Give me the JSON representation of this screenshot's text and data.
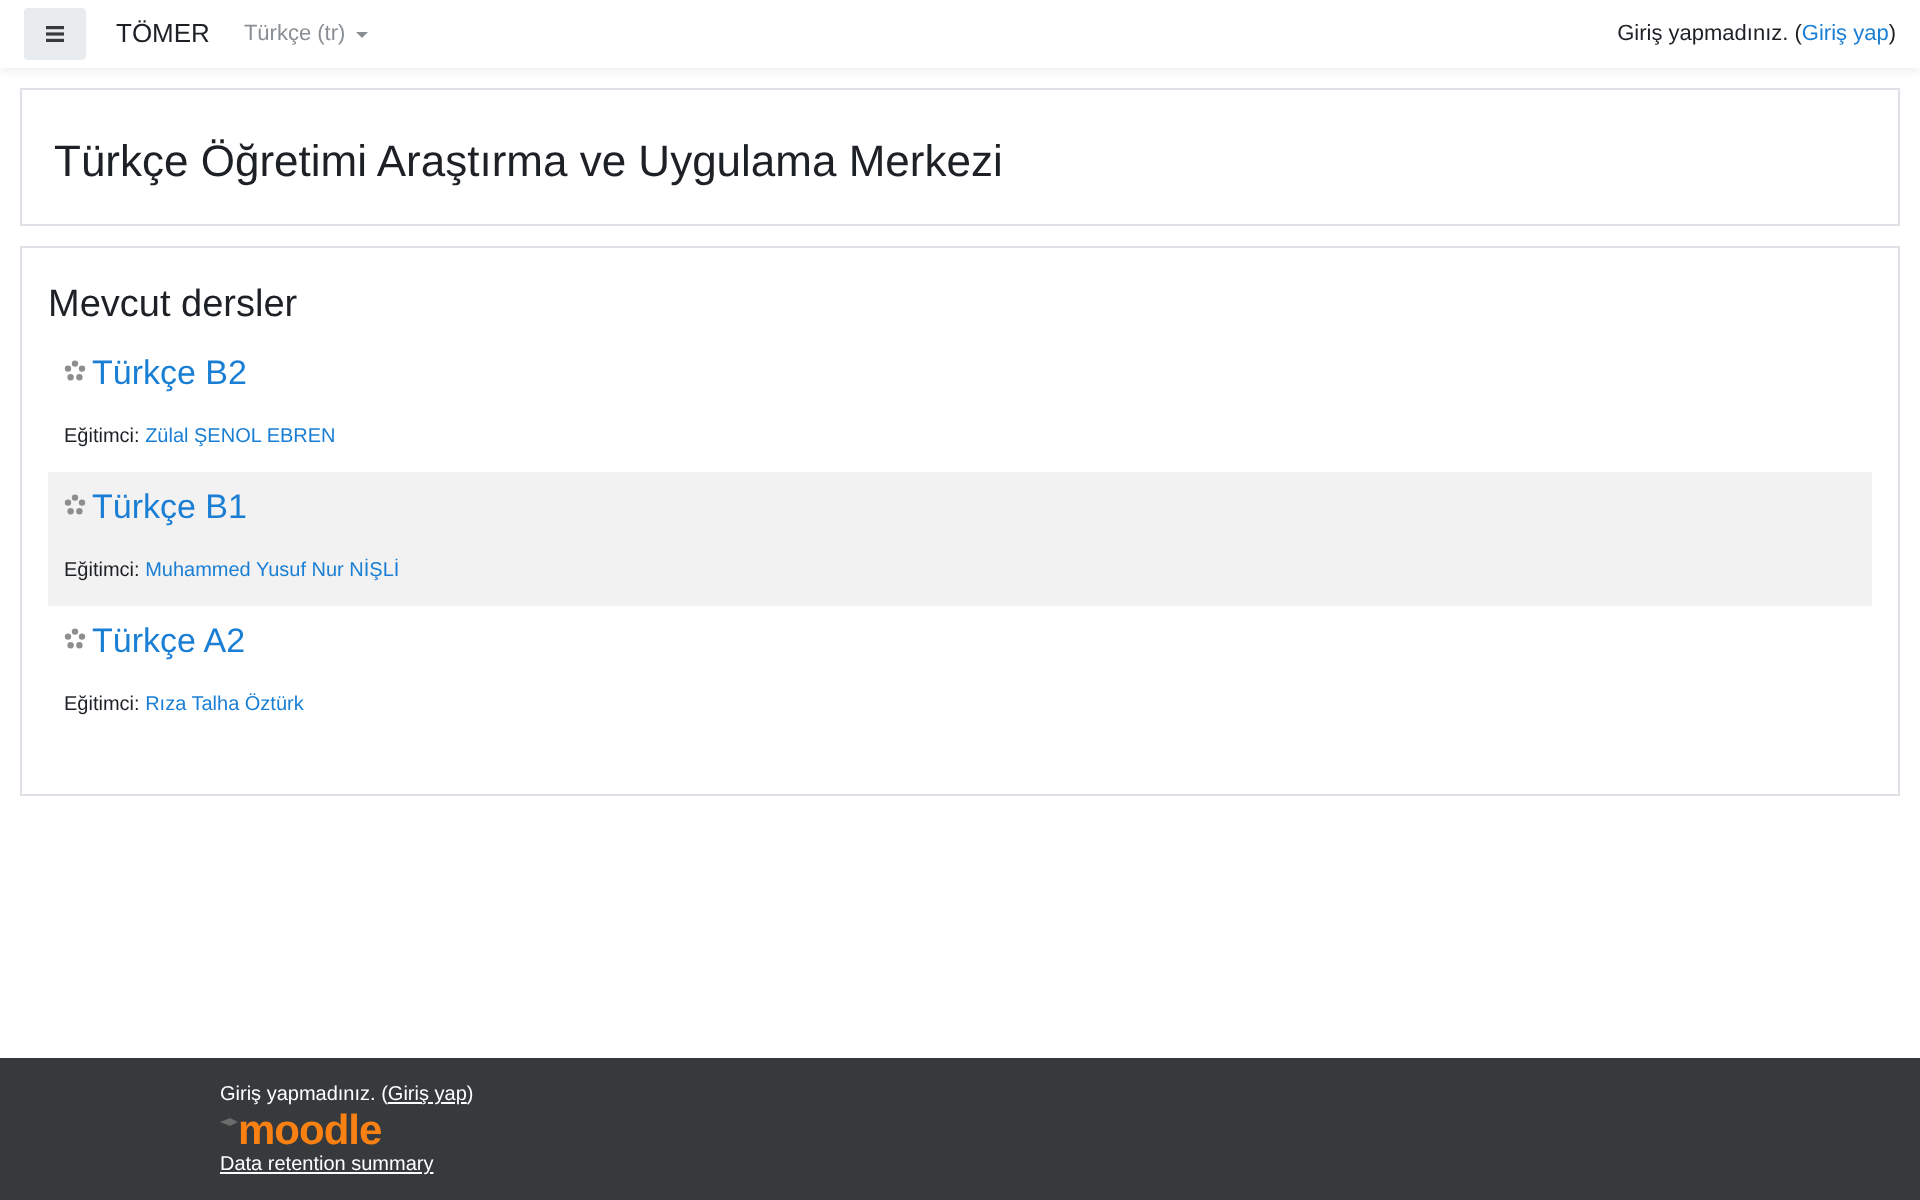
{
  "navbar": {
    "brand": "TÖMER",
    "language": "Türkçe (tr)",
    "login_info": {
      "prefix": "Giriş yapmadınız. (",
      "link": "Giriş yap",
      "suffix": ")"
    }
  },
  "page_header": {
    "title": "Türkçe Öğretimi Araştırma ve Uygulama Merkezi"
  },
  "courses": {
    "heading": "Mevcut dersler",
    "items": [
      {
        "name": "Türkçe B2",
        "teacher_label": "Eğitimci:",
        "teacher": "Zülal ŞENOL EBREN"
      },
      {
        "name": "Türkçe B1",
        "teacher_label": "Eğitimci:",
        "teacher": "Muhammed Yusuf Nur NİŞLİ"
      },
      {
        "name": "Türkçe A2",
        "teacher_label": "Eğitimci:",
        "teacher": "Rıza Talha Öztürk"
      }
    ]
  },
  "footer": {
    "login_info": {
      "prefix": "Giriş yapmadınız. (",
      "link": "Giriş yap",
      "suffix": ")"
    },
    "logo": "moodle",
    "links": [
      "Data retention summary"
    ]
  }
}
